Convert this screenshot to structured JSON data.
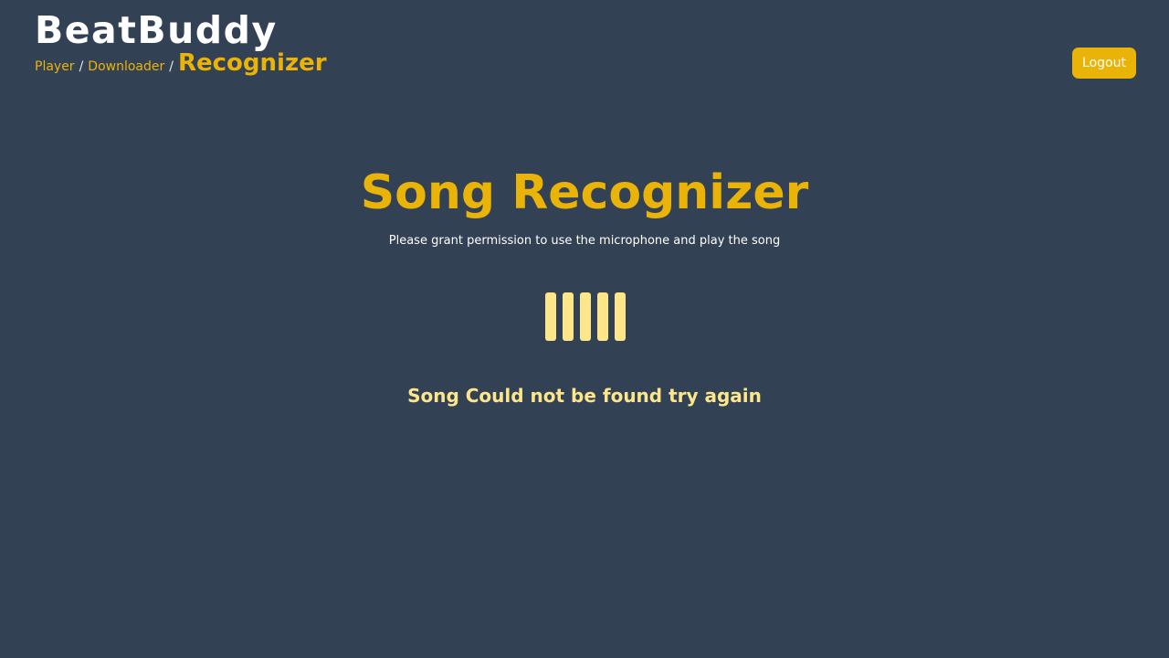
{
  "header": {
    "brand": "BeatBuddy",
    "breadcrumb": {
      "player": "Player",
      "sep1": "/",
      "downloader": "Downloader",
      "sep2": "/",
      "current": "Recognizer"
    },
    "logout_label": "Logout"
  },
  "main": {
    "title": "Song Recognizer",
    "subtitle": "Please grant permission to use the microphone and play the song",
    "record_icon": "audio-bars-icon",
    "status": "Song Could not be found try again"
  },
  "colors": {
    "background": "#334155",
    "accent": "#eab308",
    "accent_light": "#fde68a",
    "text": "#ffffff"
  }
}
